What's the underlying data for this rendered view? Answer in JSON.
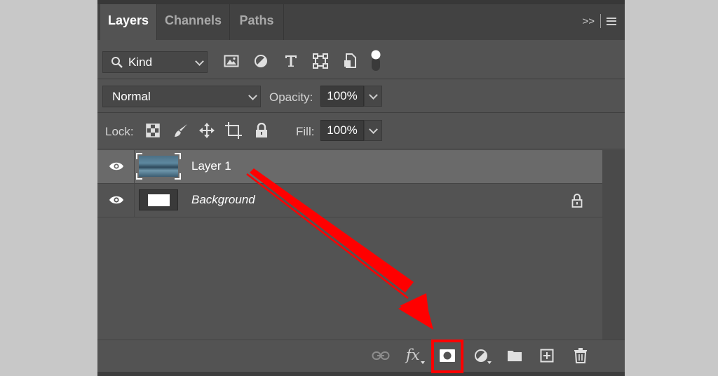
{
  "tabs": [
    {
      "label": "Layers",
      "active": true
    },
    {
      "label": "Channels",
      "active": false
    },
    {
      "label": "Paths",
      "active": false
    }
  ],
  "tab_menu": {
    "expand_label": ">>"
  },
  "filter": {
    "kind_label": "Kind"
  },
  "blend": {
    "mode": "Normal",
    "opacity_label": "Opacity:",
    "opacity_value": "100%"
  },
  "lock": {
    "label": "Lock:",
    "fill_label": "Fill:",
    "fill_value": "100%"
  },
  "layers": [
    {
      "name": "Layer 1",
      "selected": true,
      "visible": true
    },
    {
      "name": "Background",
      "selected": false,
      "visible": true,
      "locked": true
    }
  ],
  "bottom_bar": {
    "fx_label": "fx"
  },
  "colors": {
    "panel": "#535353",
    "tabbar": "#424242",
    "selected_row": "#6a6a6a",
    "annotation_red": "#ff0000",
    "page_bg": "#c8c8c8"
  }
}
